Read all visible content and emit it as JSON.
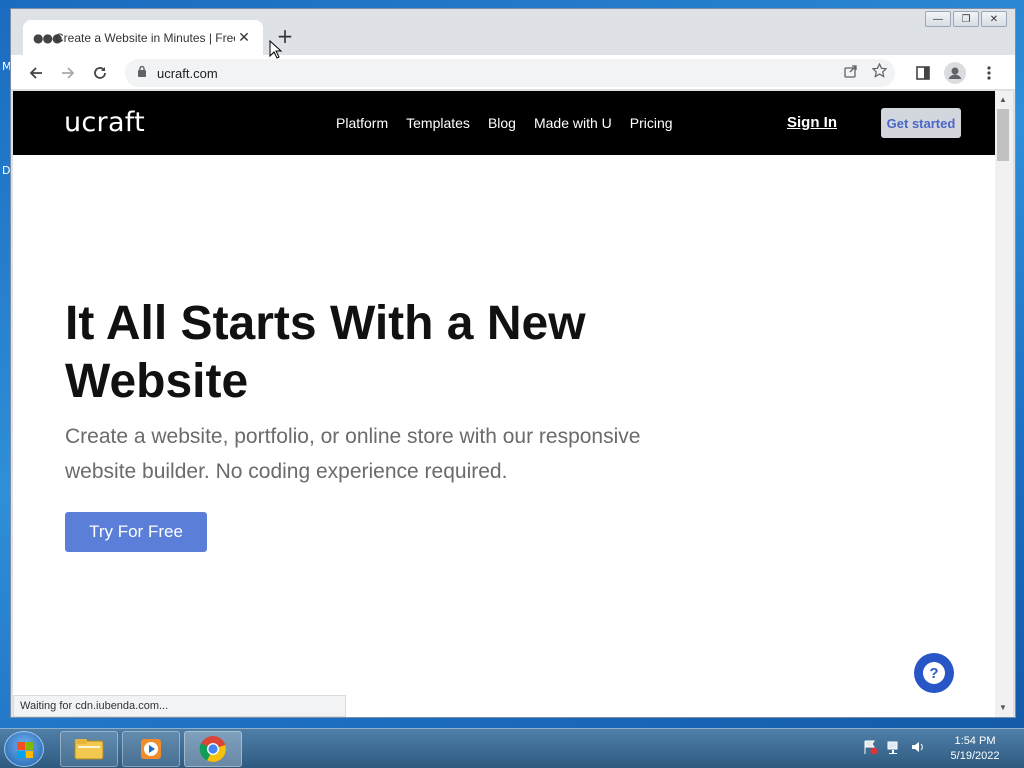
{
  "desktop": {
    "left_letters": [
      "M",
      "D"
    ]
  },
  "browser": {
    "tab_title": "Create a Website in Minutes | Free",
    "address": "ucraft.com",
    "status_text": "Waiting for cdn.iubenda.com..."
  },
  "site": {
    "logo": "ucraft",
    "nav": [
      "Platform",
      "Templates",
      "Blog",
      "Made with U",
      "Pricing"
    ],
    "sign_in": "Sign In",
    "get_started": "Get started",
    "hero_title": "It All Starts With a New Website",
    "hero_subtitle": "Create a website, portfolio, or online store with our responsive website builder. No coding experience required.",
    "cta": "Try For Free",
    "help_glyph": "?"
  },
  "taskbar": {
    "time": "1:54 PM",
    "date": "5/19/2022",
    "apps": [
      "file-explorer-icon",
      "media-player-icon",
      "chrome-icon"
    ]
  },
  "colors": {
    "nav_bg": "#000000",
    "cta": "#5b7ed9",
    "help": "#2956c6",
    "get_started_text": "#4a66c8"
  }
}
